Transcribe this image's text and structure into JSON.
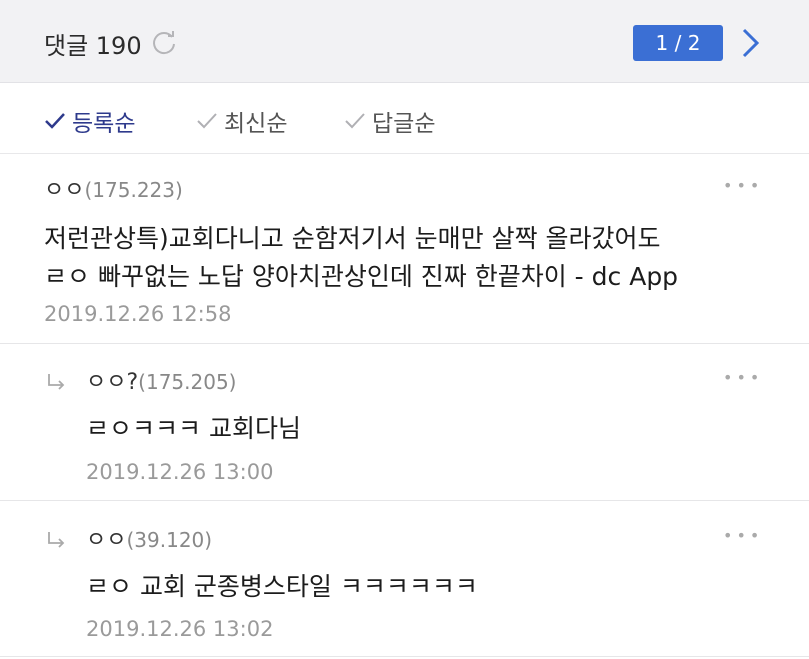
{
  "header": {
    "title": "댓글 190",
    "page_indicator": "1 / 2"
  },
  "sort": {
    "items": [
      {
        "label": "등록순",
        "active": true
      },
      {
        "label": "최신순",
        "active": false
      },
      {
        "label": "답글순",
        "active": false
      }
    ]
  },
  "comments": [
    {
      "author": "ㅇㅇ",
      "ip": "(175.223)",
      "lines": [
        "저런관상특)교회다니고 순함저기서 눈매만 살짝 올라갔어도",
        "ㄹㅇ 빠꾸없는 노답 양아치관상인데 진짜 한끝차이 - dc App"
      ],
      "time": "2019.12.26 12:58",
      "more": "•••"
    },
    {
      "author": "ㅇㅇ?",
      "ip": "(175.205)",
      "text": "ㄹㅇㅋㅋㅋ 교회다님",
      "time": "2019.12.26 13:00",
      "more": "•••"
    },
    {
      "author": "ㅇㅇ",
      "ip": "(39.120)",
      "text": "ㄹㅇ 교회 군종병스타일 ㅋㅋㅋㅋㅋㅋ",
      "time": "2019.12.26 13:02",
      "more": "•••"
    }
  ],
  "icons": {
    "refresh": "refresh-icon",
    "next": "chevron-right-icon",
    "check": "check-icon",
    "reply": "reply-arrow-icon"
  },
  "colors": {
    "accent": "#3b6fd4",
    "active_sort": "#2e3a8c",
    "header_bg": "#f2f2f4"
  }
}
